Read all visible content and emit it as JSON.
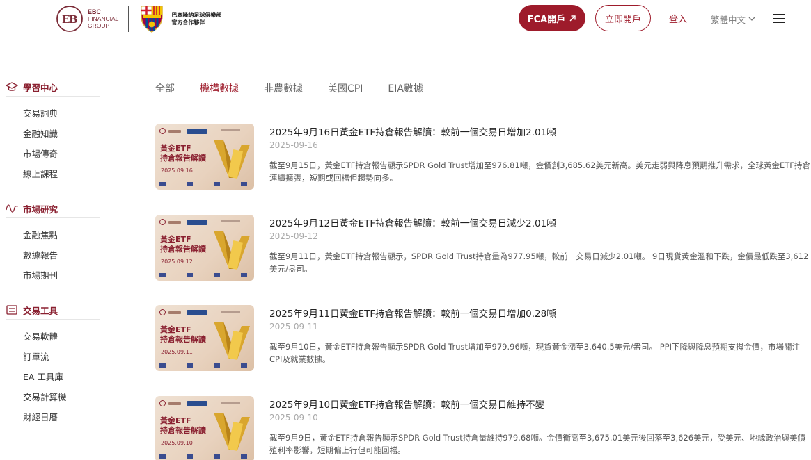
{
  "header": {
    "brand_line1": "EBC",
    "brand_line2": "FINANCIAL",
    "brand_line3": "GROUP",
    "partner_line1": "巴塞隆納足球俱樂部",
    "partner_line2": "官方合作夥伴",
    "fca_button": "FCA開戶",
    "fca_icon": "arrow-up-right-icon",
    "open_button": "立即開戶",
    "login": "登入",
    "language": "繁體中文",
    "accent_color": "#9e1b2b"
  },
  "sidebar": {
    "groups": [
      {
        "title": "學習中心",
        "icon": "graduation-cap-icon",
        "items": [
          "交易詞典",
          "金融知識",
          "市場傳奇",
          "線上課程"
        ]
      },
      {
        "title": "市場研究",
        "icon": "wave-chart-icon",
        "items": [
          "金融焦點",
          "數據報告",
          "市場期刊"
        ]
      },
      {
        "title": "交易工具",
        "icon": "toolbox-icon",
        "items": [
          "交易軟體",
          "訂單流",
          "EA 工具庫",
          "交易計算機",
          "財經日曆"
        ]
      }
    ]
  },
  "tabs": [
    {
      "label": "全部",
      "active": false
    },
    {
      "label": "機構數據",
      "active": true
    },
    {
      "label": "非農數據",
      "active": false
    },
    {
      "label": "美國CPI",
      "active": false
    },
    {
      "label": "EIA數據",
      "active": false
    }
  ],
  "articles": [
    {
      "thumb_title_1": "黃金ETF",
      "thumb_title_2": "持倉報告解讀",
      "thumb_date": "2025.09.16",
      "title": "2025年9月16日黃金ETF持倉報告解讀：較前一個交易日增加2.01噸",
      "date": "2025-09-16",
      "summary": "截至9月15日，黃金ETF持倉報告顯示SPDR Gold Trust增加至976.81噸，金價創3,685.62美元新高。美元走弱與降息預期推升需求，全球黃金ETF持倉連續擴張，短期或回檔但趨勢向多。"
    },
    {
      "thumb_title_1": "黃金ETF",
      "thumb_title_2": "持倉報告解讀",
      "thumb_date": "2025.09.12",
      "title": "2025年9月12日黃金ETF持倉報告解讀：較前一個交易日減少2.01噸",
      "date": "2025-09-12",
      "summary": "截至9月11日，黃金ETF持倉報告顯示，SPDR Gold Trust持倉量為977.95噸，較前一交易日減少2.01噸。 9日現貨黃金溫和下跌，金價最低跌至3,612美元/盎司。"
    },
    {
      "thumb_title_1": "黃金ETF",
      "thumb_title_2": "持倉報告解讀",
      "thumb_date": "2025.09.11",
      "title": "2025年9月11日黃金ETF持倉報告解讀：較前一個交易日增加0.28噸",
      "date": "2025-09-11",
      "summary": "截至9月10日，黃金ETF持倉報告顯示SPDR Gold Trust增加至979.96噸，現貨黃金漲至3,640.5美元/盎司。 PPI下降與降息預期支撐金價，市場關注CPI及就業數據。"
    },
    {
      "thumb_title_1": "黃金ETF",
      "thumb_title_2": "持倉報告解讀",
      "thumb_date": "2025.09.10",
      "title": "2025年9月10日黃金ETF持倉報告解讀：較前一個交易日維持不變",
      "date": "2025-09-10",
      "summary": "截至9月9日，黃金ETF持倉報告顯示SPDR Gold Trust持倉量維持979.68噸。金價衝高至3,675.01美元後回落至3,626美元，受美元、地緣政治與美債殖利率影響，短期偏上行但可能回檔。"
    }
  ]
}
